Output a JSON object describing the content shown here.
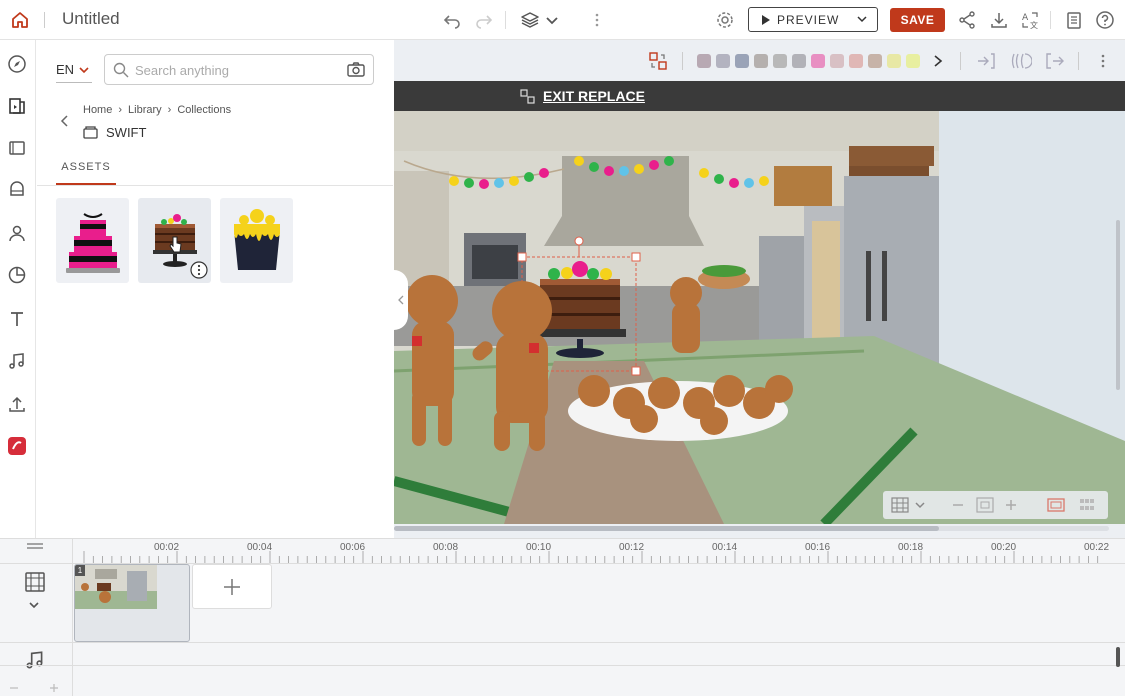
{
  "header": {
    "title": "Untitled",
    "preview_label": "PREVIEW",
    "save_label": "SAVE"
  },
  "panel": {
    "language": "EN",
    "search_placeholder": "Search anything",
    "breadcrumb": [
      "Home",
      "Library",
      "Collections"
    ],
    "collection_name": "SWIFT",
    "tab_assets": "ASSETS"
  },
  "canvas": {
    "exit_replace_label": "EXIT REPLACE",
    "color_swatches": [
      "#b8a9b3",
      "#b3b3c0",
      "#9aa3b7",
      "#b5b0ae",
      "#b8b8b8",
      "#b2b2b8",
      "#e88fc2",
      "#d8c0c4",
      "#e0b7b5",
      "#c7b3a8",
      "#e8e8a5",
      "#e8efa0"
    ]
  },
  "timeline": {
    "ticks": [
      "00:02",
      "00:04",
      "00:06",
      "00:08",
      "00:10",
      "00:12",
      "00:14",
      "00:16",
      "00:18",
      "00:20",
      "00:22"
    ],
    "scene_number": "1"
  },
  "colors": {
    "accent": "#c0391b",
    "replace_bar": "#3a3a3a"
  },
  "icons": {
    "home": "home-icon",
    "undo": "undo-icon",
    "redo": "redo-icon",
    "layers": "layers-icon",
    "settings": "gear-icon",
    "share": "share-icon",
    "download": "download-icon",
    "translate": "translate-icon",
    "notes": "notes-icon",
    "help": "help-icon"
  }
}
